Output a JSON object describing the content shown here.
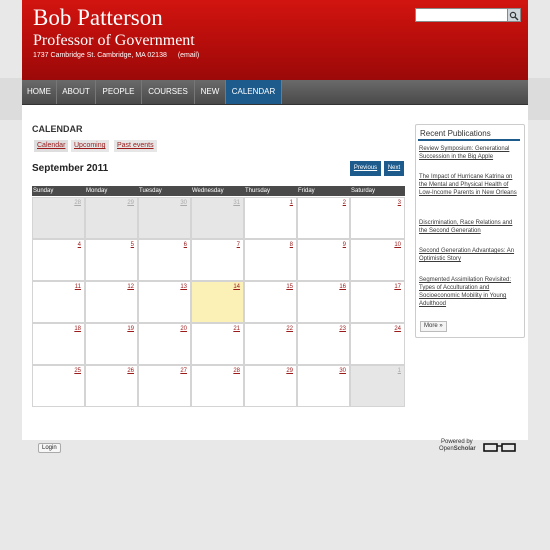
{
  "header": {
    "name": "Bob Patterson",
    "title": "Professor of Government",
    "address": "1737 Cambridge St. Cambridge, MA 02138",
    "email": "(email)"
  },
  "search": {
    "placeholder": ""
  },
  "nav": [
    "HOME",
    "ABOUT",
    "PEOPLE",
    "COURSES",
    "NEW",
    "CALENDAR"
  ],
  "calendar": {
    "heading": "CALENDAR",
    "tabs": [
      "Calendar",
      "Upcoming",
      "Past events"
    ],
    "month": "September 2011",
    "prev": "Previous",
    "next": "Next",
    "days": [
      "Sunday",
      "Monday",
      "Tuesday",
      "Wednesday",
      "Thursday",
      "Friday",
      "Saturday"
    ],
    "weeks": [
      [
        "28",
        "29",
        "30",
        "31",
        "1",
        "2",
        "3"
      ],
      [
        "4",
        "5",
        "6",
        "7",
        "8",
        "9",
        "10"
      ],
      [
        "11",
        "12",
        "13",
        "14",
        "15",
        "16",
        "17"
      ],
      [
        "18",
        "19",
        "20",
        "21",
        "22",
        "23",
        "24"
      ],
      [
        "25",
        "26",
        "27",
        "28",
        "29",
        "30",
        "1"
      ]
    ]
  },
  "sidebar": {
    "title": "Recent Publications",
    "items": [
      "Review Symposium: Generational Succession in the Big Apple",
      "The Impact of Hurricane Katrina on the Mental and Physical Health of Low-Income Parents in New Orleans",
      "Discrimination, Race Relations and the Second Generation",
      "Second Generation Advantages: An Optimistic Story",
      "Segmented Assimilation Revisited: Types of Acculturation and Socioeconomic Mobility in Young Adulthood"
    ],
    "more": "More »"
  },
  "footer": {
    "login": "Login",
    "powered": "Powered by",
    "brand_open": "Open",
    "brand_scholar": "Scholar"
  }
}
